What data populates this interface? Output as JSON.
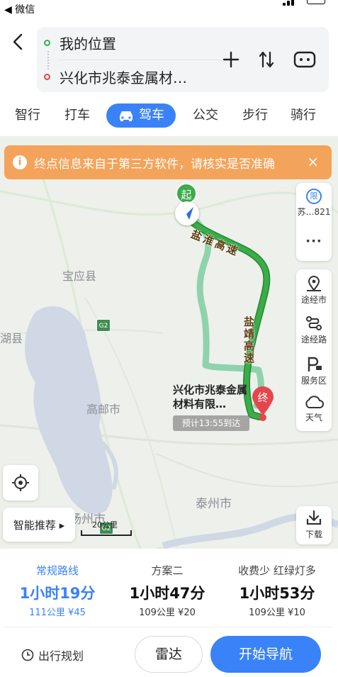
{
  "status_bar": {
    "back_label": "◀ 微信"
  },
  "route": {
    "origin": "我的位置",
    "destination": "兴化市兆泰金属材…"
  },
  "tabs": [
    "智行",
    "打车",
    "驾车",
    "公交",
    "步行",
    "骑行"
  ],
  "active_tab": "驾车",
  "banner": {
    "text": "终点信息来自于第三方软件，请核实是否准确",
    "info_icon": "i",
    "close_icon": "×"
  },
  "map": {
    "labels": {
      "baoying": "宝应县",
      "hu": "湖县",
      "gaoyou": "高邮市",
      "taizhou": "泰州市",
      "yangzhou": "扬州市"
    },
    "highway_badges": [
      "G2",
      "G2"
    ],
    "highway_names": [
      "盐淮高速",
      "盐靖高速"
    ],
    "start_marker": "起",
    "end_marker": "终",
    "destination_card": "兴化市兆泰金属材料有限…",
    "eta": "预计13:55到达",
    "colors": {
      "route_main": "#3cab4a",
      "route_alt": "#8ed3ab",
      "water": "#cfd8e4"
    }
  },
  "side_panel": {
    "restriction": {
      "icon_text": "限",
      "label": "苏…821"
    },
    "more": "···",
    "tools": [
      {
        "label": "途经市",
        "icon": "map-pin-icon"
      },
      {
        "label": "途经路",
        "icon": "route-icon"
      },
      {
        "label": "服务区",
        "icon": "parking-icon"
      },
      {
        "label": "天气",
        "icon": "cloud-icon"
      }
    ]
  },
  "smart_recommend": "智能推荐 ▸",
  "scale": "20公里",
  "download": "下载",
  "options": [
    {
      "name": "常规路线",
      "time": "1小时19分",
      "meta": "111公里 ¥45",
      "selected": true
    },
    {
      "name": "方案二",
      "time": "1小时47分",
      "meta": "109公里 ¥20",
      "selected": false
    },
    {
      "name": "收费少  红绿灯多",
      "time": "1小时53分",
      "meta": "109公里 ¥10",
      "selected": false
    }
  ],
  "bottom": {
    "plan": "出行规划",
    "radar": "雷达",
    "start_nav": "开始导航"
  }
}
